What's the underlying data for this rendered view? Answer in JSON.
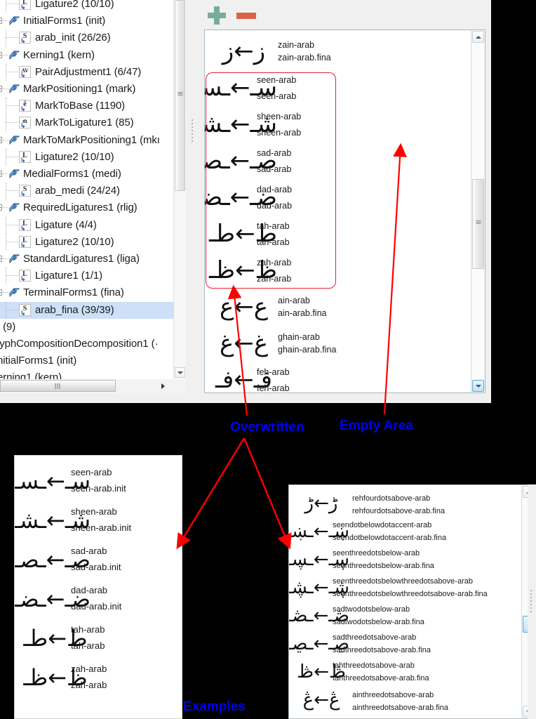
{
  "app": {
    "toolbar": {
      "add_label": "+",
      "remove_label": "−"
    }
  },
  "tree": {
    "items": [
      {
        "label": "Ligature2 (10/10)",
        "depth": 2,
        "icon": "lookup-ligature-icon",
        "glyph": "L",
        "selected": false
      },
      {
        "label": "InitialForms1 (init)",
        "depth": 1,
        "icon": "feature-tag-icon",
        "glyph": "",
        "selected": false
      },
      {
        "label": "arab_init (26/26)",
        "depth": 2,
        "icon": "lookup-substitution-icon",
        "glyph": "S",
        "selected": false
      },
      {
        "label": "Kerning1 (kern)",
        "depth": 1,
        "icon": "feature-tag-icon",
        "glyph": "",
        "selected": false
      },
      {
        "label": "PairAdjustment1 (6/47)",
        "depth": 2,
        "icon": "lookup-pair-icon",
        "glyph": "AV",
        "selected": false
      },
      {
        "label": "MarkPositioning1 (mark)",
        "depth": 1,
        "icon": "feature-tag-icon",
        "glyph": "",
        "selected": false
      },
      {
        "label": "MarkToBase (1190)",
        "depth": 2,
        "icon": "lookup-mark-icon",
        "glyph": "ê",
        "selected": false
      },
      {
        "label": "MarkToLigature1 (85)",
        "depth": 2,
        "icon": "lookup-mark-icon",
        "glyph": "m̈",
        "selected": false
      },
      {
        "label": "MarkToMarkPositioning1 (mkı",
        "depth": 1,
        "icon": "feature-tag-icon",
        "glyph": "",
        "selected": false
      },
      {
        "label": "Ligature2 (10/10)",
        "depth": 2,
        "icon": "lookup-ligature-icon",
        "glyph": "L",
        "selected": false
      },
      {
        "label": "MedialForms1 (medi)",
        "depth": 1,
        "icon": "feature-tag-icon",
        "glyph": "",
        "selected": false
      },
      {
        "label": "arab_medi (24/24)",
        "depth": 2,
        "icon": "lookup-substitution-icon",
        "glyph": "S",
        "selected": false
      },
      {
        "label": "RequiredLigatures1 (rlig)",
        "depth": 1,
        "icon": "feature-tag-icon",
        "glyph": "",
        "selected": false
      },
      {
        "label": "Ligature (4/4)",
        "depth": 2,
        "icon": "lookup-ligature-icon",
        "glyph": "L",
        "selected": false
      },
      {
        "label": "Ligature2 (10/10)",
        "depth": 2,
        "icon": "lookup-ligature-icon",
        "glyph": "L",
        "selected": false
      },
      {
        "label": "StandardLigatures1 (liga)",
        "depth": 1,
        "icon": "feature-tag-icon",
        "glyph": "",
        "selected": false
      },
      {
        "label": "Ligature1 (1/1)",
        "depth": 2,
        "icon": "lookup-ligature-icon",
        "glyph": "L",
        "selected": false
      },
      {
        "label": "TerminalForms1 (fina)",
        "depth": 1,
        "icon": "feature-tag-icon",
        "glyph": "",
        "selected": false
      },
      {
        "label": "arab_fina (39/39)",
        "depth": 2,
        "icon": "lookup-substitution-icon",
        "glyph": "S",
        "selected": true
      },
      {
        "label": "; (9)",
        "depth": 0,
        "icon": "none",
        "glyph": "",
        "selected": false
      },
      {
        "label": "lyphCompositionDecomposition1 (·",
        "depth": 0,
        "icon": "none",
        "glyph": "",
        "selected": false
      },
      {
        "label": "nitialForms1 (init)",
        "depth": 0,
        "icon": "none",
        "glyph": "",
        "selected": false
      },
      {
        "label": "erning1 (kern)",
        "depth": 0,
        "icon": "none",
        "glyph": "",
        "selected": false
      }
    ]
  },
  "glyph_list": {
    "rows": [
      {
        "art": "ز←ز",
        "name1": "zain-arab",
        "name2": "zain-arab.fina",
        "overwritten": false
      },
      {
        "art": "سـ←ـسـ",
        "name1": "seen-arab",
        "name2": "seen-arab",
        "overwritten": true
      },
      {
        "art": "شـ←ـشـ",
        "name1": "sheen-arab",
        "name2": "sheen-arab",
        "overwritten": true
      },
      {
        "art": "صـ←ـصـ",
        "name1": "sad-arab",
        "name2": "sad-arab",
        "overwritten": true
      },
      {
        "art": "ضـ←ـضـ",
        "name1": "dad-arab",
        "name2": "dad-arab",
        "overwritten": true
      },
      {
        "art": "ط←طـ",
        "name1": "tah-arab",
        "name2": "tah-arab",
        "overwritten": true
      },
      {
        "art": "ظ←ظـ",
        "name1": "zah-arab",
        "name2": "zah-arab",
        "overwritten": true
      },
      {
        "art": "ع←ع",
        "name1": "ain-arab",
        "name2": "ain-arab.fina",
        "overwritten": false
      },
      {
        "art": "غ←غ",
        "name1": "ghain-arab",
        "name2": "ghain-arab.fina",
        "overwritten": false
      },
      {
        "art": "فـ←فـ",
        "name1": "feh-arab",
        "name2": "feh-arab",
        "overwritten": true
      }
    ]
  },
  "examples_panel": {
    "rows": [
      {
        "art": "سـ←ـسـ",
        "name1": "seen-arab",
        "name2": "seen-arab.init",
        "overwritten": true
      },
      {
        "art": "شـ←ـشـ",
        "name1": "sheen-arab",
        "name2": "sheen-arab.init",
        "overwritten": true
      },
      {
        "art": "صـ←ـصـ",
        "name1": "sad-arab",
        "name2": "sad-arab.init",
        "overwritten": true
      },
      {
        "art": "ضـ←ـضـ",
        "name1": "dad-arab",
        "name2": "dad-arab.init",
        "overwritten": true
      },
      {
        "art": "ط←طـ",
        "name1": "tah-arab",
        "name2": "tah-arab",
        "overwritten": true
      },
      {
        "art": "ظ←ظـ",
        "name1": "zah-arab",
        "name2": "zah-arab",
        "overwritten": true
      }
    ]
  },
  "long_names_panel": {
    "rows": [
      {
        "art": "ڑ←ڑ",
        "name1": "rehfourdotsabove-arab",
        "name2": "rehfourdotsabove-arab.fina",
        "spaced": true
      },
      {
        "art": "ښـ←ـښـ",
        "name1": "seendotbelowdotaccent-arab",
        "name2": "seendotbelowdotaccent-arab.fina",
        "spaced": false
      },
      {
        "art": "ڛـ←ـڛـ",
        "name1": "seenthreedotsbelow-arab",
        "name2": "seenthreedotsbelow-arab.fina",
        "spaced": false
      },
      {
        "art": "ڜـ←ـڜـ",
        "name1": "seenthreedotsbelowthreedotsabove-arab",
        "name2": "seenthreedotsbelowthreedotsabove-arab.fina",
        "spaced": false
      },
      {
        "art": "ڞـ←ـڞـ",
        "name1": "sadtwodotsbelow-arab",
        "name2": "sadtwodotsbelow-arab.fina",
        "spaced": false
      },
      {
        "art": "ڝـ←ـڝـ",
        "name1": "sadthreedotsabove-arab",
        "name2": "sadthreedotsabove-arab.fina",
        "spaced": false
      },
      {
        "art": "ڟ←ڟ",
        "name1": "tahthreedotsabove-arab",
        "name2": "tahthreedotsabove-arab.fina",
        "spaced": false
      },
      {
        "art": "ڠ←ڠ",
        "name1": "ainthreedotsabove-arab",
        "name2": "ainthreedotsabove-arab.fina",
        "spaced": true
      }
    ]
  },
  "annotations": {
    "overwritten": "Overwritten",
    "empty_area": "Empty Area",
    "examples": "Examples",
    "color": "#0000f0",
    "arrow_color": "#ff0000"
  }
}
